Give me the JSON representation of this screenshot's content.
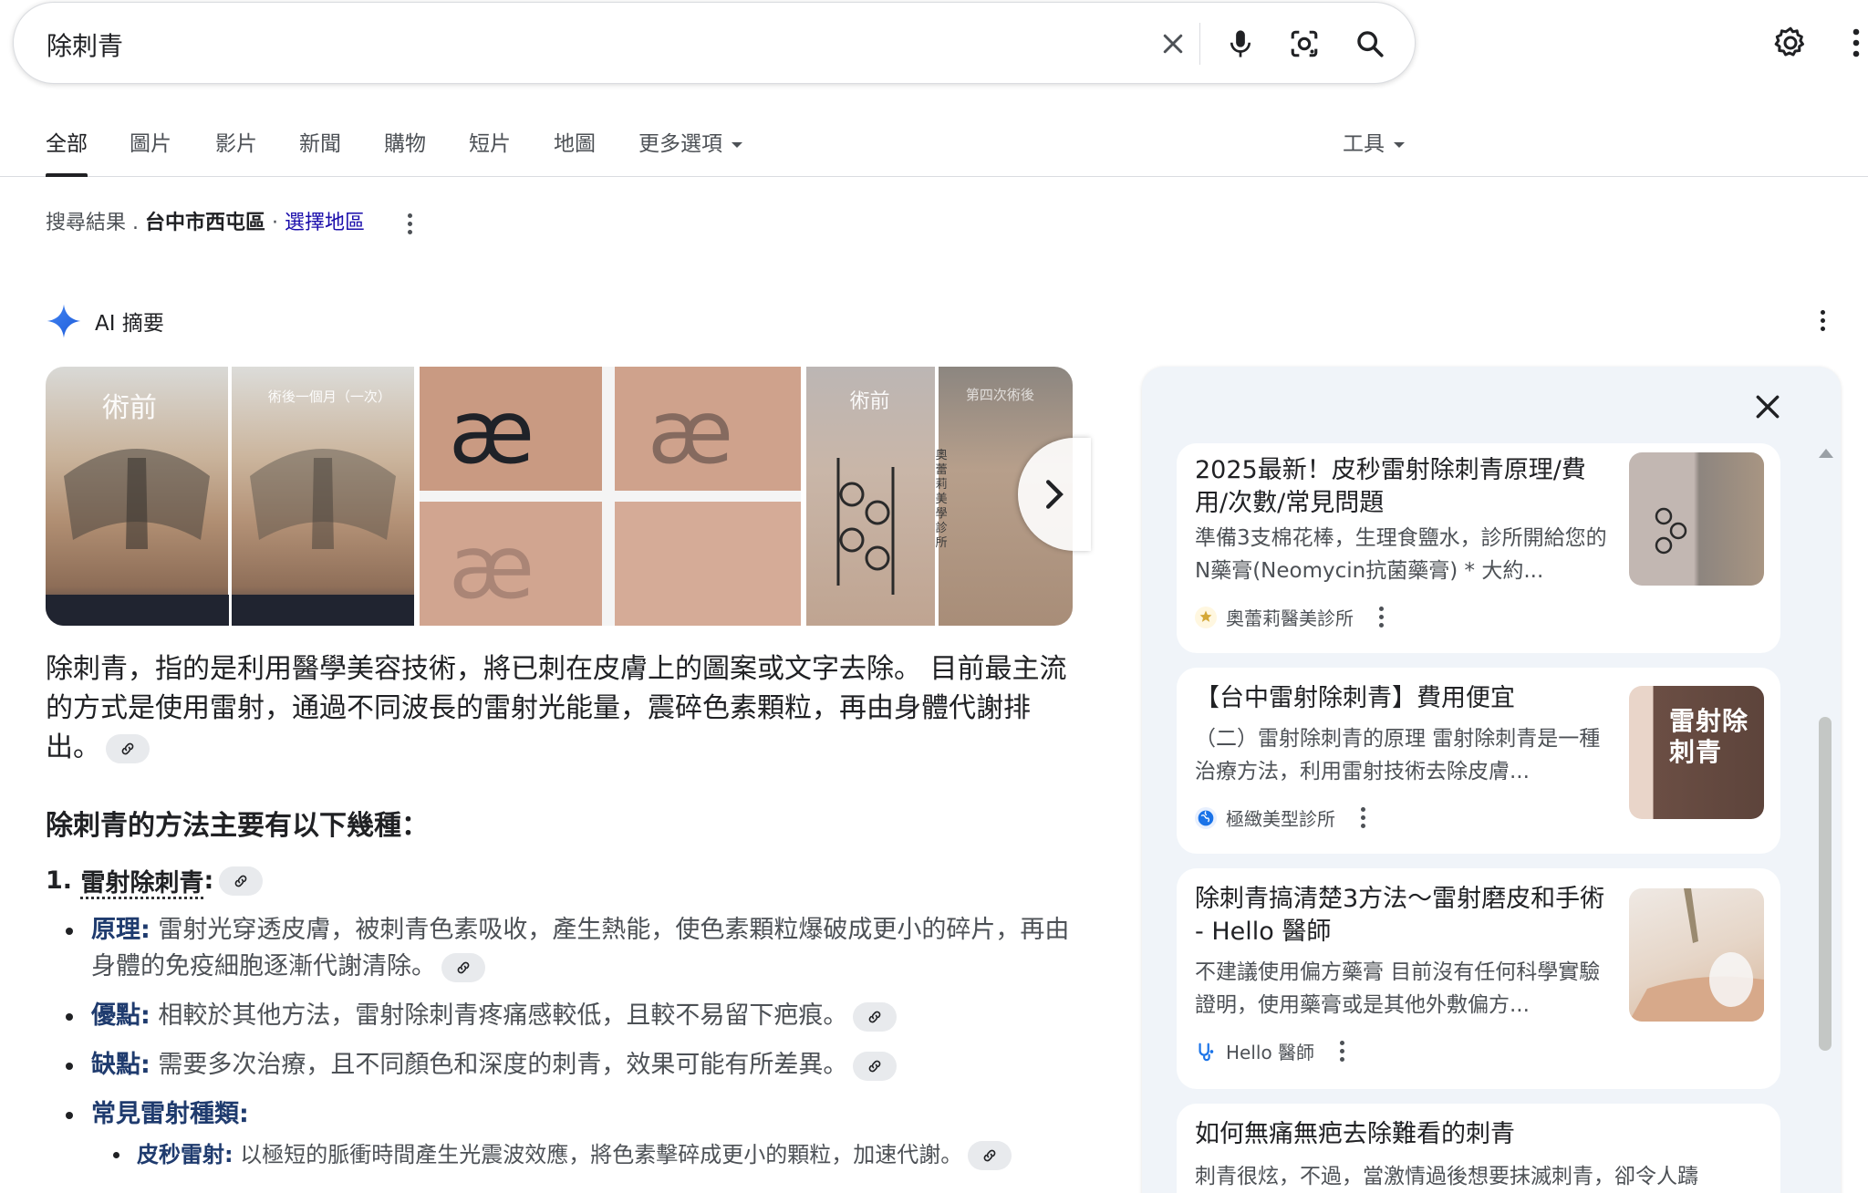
{
  "search": {
    "query": "除刺青"
  },
  "tabs": [
    {
      "label": "全部"
    },
    {
      "label": "圖片"
    },
    {
      "label": "影片"
    },
    {
      "label": "新聞"
    },
    {
      "label": "購物"
    },
    {
      "label": "短片"
    },
    {
      "label": "地圖"
    },
    {
      "label": "更多選項"
    }
  ],
  "tools_label": "工具",
  "location": {
    "prefix": "搜尋結果",
    "area": "台中市西屯區",
    "choose": "選擇地區"
  },
  "ai": {
    "title": "AI 摘要",
    "images": [
      {
        "label": "術前"
      },
      {
        "label": "術後一個月（一次）"
      },
      {
        "label": "æ"
      },
      {
        "label": "æ"
      },
      {
        "label": "æ"
      },
      {
        "label": "術前"
      },
      {
        "label": "第四次術後"
      },
      {
        "label": "奧蕾莉美學診所"
      }
    ],
    "intro": "除刺青，指的是利用醫學美容技術，將已刺在皮膚上的圖案或文字去除。 目前最主流的方式是使用雷射，通過不同波長的雷射光能量，震碎色素顆粒，再由身體代謝排出。",
    "methods_heading": "除刺青的方法主要有以下幾種：",
    "method1_number": "1.",
    "method1_title": "雷射除刺青",
    "method1_colon": ":",
    "bullets": [
      {
        "label": "原理:",
        "text": "雷射光穿透皮膚，被刺青色素吸收，產生熱能，使色素顆粒爆破成更小的碎片，再由身體的免疫細胞逐漸代謝清除。"
      },
      {
        "label": "優點:",
        "text": "相較於其他方法，雷射除刺青疼痛感較低，且較不易留下疤痕。"
      },
      {
        "label": "缺點:",
        "text": "需要多次治療，且不同顏色和深度的刺青，效果可能有所差異。"
      },
      {
        "label": "常見雷射種類:",
        "text": ""
      }
    ],
    "sub_bullet": {
      "label": "皮秒雷射:",
      "text": "以極短的脈衝時間產生光震波效應，將色素擊碎成更小的顆粒，加速代謝。"
    }
  },
  "sources": [
    {
      "title": "2025最新！皮秒雷射除刺青原理/費用/次數/常見問題",
      "snippet": "準備3支棉花棒，生理食鹽水，診所開給您的N藥膏(Neomycin抗菌藥膏) * 大約...",
      "site": "奧蕾莉醫美診所"
    },
    {
      "title": "【台中雷射除刺青】費用便宜",
      "snippet": "（二）雷射除刺青的原理 雷射除刺青是一種治療方法，利用雷射技術去除皮膚...",
      "site": "極緻美型診所",
      "thumb_text": "雷射除刺青"
    },
    {
      "title": "除刺青搞清楚3方法～雷射磨皮和手術 - Hello 醫師",
      "snippet": "不建議使用偏方藥膏 目前沒有任何科學實驗證明，使用藥膏或是其他外敷偏方...",
      "site": "Hello 醫師"
    },
    {
      "title": "如何無痛無疤去除難看的刺青",
      "snippet": "刺青很炫，不過，當激情過後想要抹滅刺青，卻令人躊"
    }
  ],
  "colors": {
    "link": "#1a0dab",
    "ai_star": "#4285f4",
    "panel_bg": "#f0f4f9"
  }
}
